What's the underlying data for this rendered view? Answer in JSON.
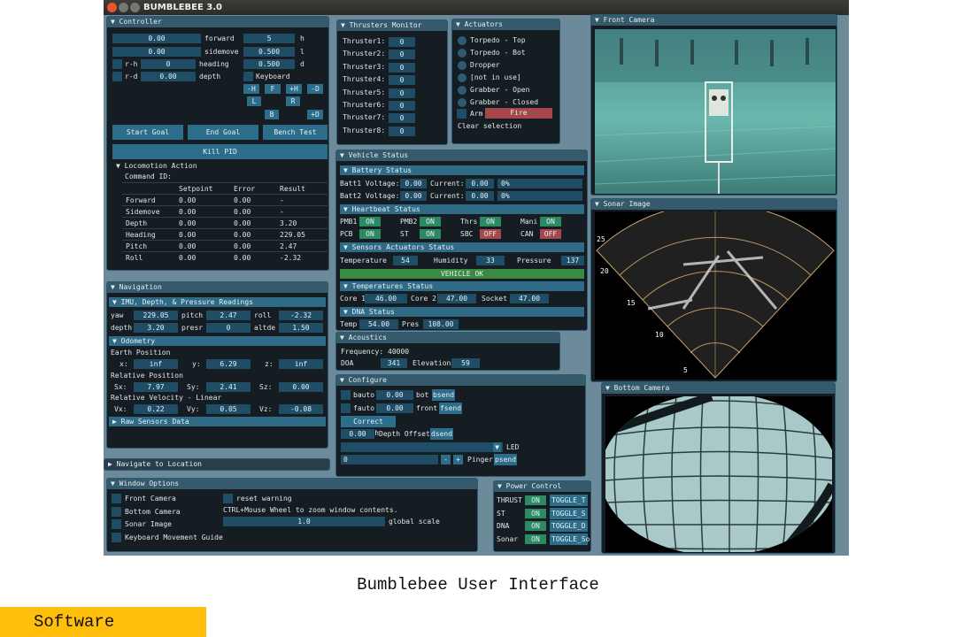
{
  "app": {
    "title": "BUMBLEBEE 3.0"
  },
  "caption": "Bumblebee User Interface",
  "tag": "Software",
  "colors": {
    "accent": "#2d6d8c",
    "on": "#2c8a63",
    "off": "#a5484b",
    "ok": "#3a8a43"
  },
  "controller": {
    "title": "Controller",
    "forward": {
      "value": "0.00",
      "label": "forward"
    },
    "sidemove": {
      "value": "0.00",
      "label": "sidemove"
    },
    "heading": {
      "check": "r-h",
      "value": "0",
      "label": "heading"
    },
    "depth": {
      "check": "r-d",
      "value": "0.00",
      "label": "depth"
    },
    "h": {
      "value": "5",
      "label": "h"
    },
    "l": {
      "value": "0.500",
      "label": "l"
    },
    "d": {
      "value": "0.500",
      "label": "d"
    },
    "keyboard": "Keyboard",
    "keys": [
      "-H",
      "F",
      "+H",
      "-D",
      "L",
      "R",
      "B",
      "+D"
    ],
    "start_goal": "Start Goal",
    "end_goal": "End Goal",
    "bench_test": "Bench Test",
    "kill_pid": "Kill PID",
    "locomotion": "Locomotion Action",
    "command_id": "Command ID:",
    "table_headers": [
      "",
      "Setpoint",
      "Error",
      "Result"
    ],
    "table_rows": [
      [
        "Forward",
        "0.00",
        "0.00",
        "-"
      ],
      [
        "Sidemove",
        "0.00",
        "0.00",
        "-"
      ],
      [
        "Depth",
        "0.00",
        "0.00",
        "3.20"
      ],
      [
        "Heading",
        "0.00",
        "0.00",
        "229.05"
      ],
      [
        "Pitch",
        "0.00",
        "0.00",
        "2.47"
      ],
      [
        "Roll",
        "0.00",
        "0.00",
        "-2.32"
      ]
    ]
  },
  "thrusters": {
    "title": "Thrusters Monitor",
    "items": [
      {
        "label": "Thruster1:",
        "value": "0"
      },
      {
        "label": "Thruster2:",
        "value": "0"
      },
      {
        "label": "Thruster3:",
        "value": "0"
      },
      {
        "label": "Thruster4:",
        "value": "0"
      },
      {
        "label": "Thruster5:",
        "value": "0"
      },
      {
        "label": "Thruster6:",
        "value": "0"
      },
      {
        "label": "Thruster7:",
        "value": "0"
      },
      {
        "label": "Thruster8:",
        "value": "0"
      }
    ]
  },
  "actuators": {
    "title": "Actuators",
    "items": [
      "Torpedo - Top",
      "Torpedo - Bot",
      "Dropper",
      "[not in use]",
      "Grabber - Open",
      "Grabber - Closed"
    ],
    "arm": "Arm",
    "fire": "Fire",
    "clear": "Clear selection"
  },
  "front_camera": {
    "title": "Front Camera"
  },
  "sonar": {
    "title": "Sonar Image",
    "ranges": [
      "25",
      "20",
      "15",
      "10",
      "5"
    ]
  },
  "bottom_camera": {
    "title": "Bottom Camera"
  },
  "vehicle": {
    "title": "Vehicle Status",
    "battery": {
      "title": "Battery Status",
      "rows": [
        {
          "label": "Batt1 Voltage:",
          "voltage": "0.00",
          "current_label": "Current:",
          "current": "0.00",
          "percent": "0%"
        },
        {
          "label": "Batt2 Voltage:",
          "voltage": "0.00",
          "current_label": "Current:",
          "current": "0.00",
          "percent": "0%"
        }
      ]
    },
    "heartbeat": {
      "title": "Heartbeat Status",
      "items": [
        {
          "label": "PMB1",
          "state": "ON"
        },
        {
          "label": "PMB2",
          "state": "ON"
        },
        {
          "label": "Thrs",
          "state": "ON"
        },
        {
          "label": "Mani",
          "state": "ON"
        },
        {
          "label": "PCB",
          "state": "ON"
        },
        {
          "label": "ST",
          "state": "ON"
        },
        {
          "label": "SBC",
          "state": "OFF"
        },
        {
          "label": "CAN",
          "state": "OFF"
        }
      ]
    },
    "sensors": {
      "title": "Sensors Actuators Status",
      "temperature_label": "Temperature",
      "temperature": "54",
      "humidity_label": "Humidity",
      "humidity": "33",
      "pressure_label": "Pressure",
      "pressure": "137",
      "vehicle_ok": "VEHICLE OK"
    },
    "temperatures": {
      "title": "Temperatures Status",
      "core1_label": "Core 1",
      "core1": "46.00",
      "core2_label": "Core 2",
      "core2": "47.00",
      "socket_label": "Socket",
      "socket": "47.00"
    },
    "dna": {
      "title": "DNA Status",
      "temp_label": "Temp",
      "temp": "54.00",
      "pres_label": "Pres",
      "pres": "108.00"
    }
  },
  "navigation": {
    "title": "Navigation",
    "imu": {
      "title": "IMU, Depth, & Pressure Readings",
      "yaw_label": "yaw",
      "yaw": "229.05",
      "pitch_label": "pitch",
      "pitch": "2.47",
      "roll_label": "roll",
      "roll": "-2.32",
      "depth_label": "depth",
      "depth": "3.20",
      "presr_label": "presr",
      "presr": "0",
      "altde_label": "altde",
      "altde": "1.50"
    },
    "odometry": {
      "title": "Odometry",
      "earth_label": "Earth Position",
      "x_label": "x:",
      "x": "inf",
      "y_label": "y:",
      "y": "6.29",
      "z_label": "z:",
      "z": "inf",
      "relative_label": "Relative Position",
      "sx_label": "Sx:",
      "sx": "7.97",
      "sy_label": "Sy:",
      "sy": "2.41",
      "sz_label": "Sz:",
      "sz": "0.00",
      "velocity_label": "Relative Velocity - Linear",
      "vx_label": "Vx:",
      "vx": "0.22",
      "vy_label": "Vy:",
      "vy": "0.05",
      "vz_label": "Vz:",
      "vz": "-0.08"
    },
    "raw": "Raw Sensors Data"
  },
  "navigate_to": {
    "title": "Navigate to Location"
  },
  "acoustics": {
    "title": "Acoustics",
    "frequency_label": "Frequency:",
    "frequency": "40000",
    "doa_label": "DOA",
    "doa": "341",
    "elevation_label": "Elevation",
    "elevation": "59"
  },
  "configure": {
    "title": "Configure",
    "bauto": "bauto",
    "bauto_value": "0.00",
    "bot": "bot",
    "bsend": "bsend",
    "fauto": "fauto",
    "fauto_value": "0.00",
    "front": "front",
    "fsend": "fsend",
    "correct_depth": "Correct depth",
    "depth_offset_value": "0.00",
    "depth_offset": "Depth Offset",
    "dsend": "dsend",
    "led": "LED",
    "pinger_value": "0",
    "minus": "-",
    "plus": "+",
    "pinger": "Pinger",
    "psend": "psend"
  },
  "window_options": {
    "title": "Window Options",
    "items": [
      "Front Camera",
      "Bottom Camera",
      "Sonar Image",
      "Keyboard Movement Guide"
    ],
    "reset_warning": "reset warning",
    "zoom_hint": "CTRL+Mouse Wheel to zoom window contents.",
    "global_scale_value": "1.0",
    "global_scale": "global scale"
  },
  "power": {
    "title": "Power Control",
    "rows": [
      {
        "label": "THRUST",
        "state": "ON",
        "toggle": "TOGGLE_T"
      },
      {
        "label": "ST",
        "state": "ON",
        "toggle": "TOGGLE_S"
      },
      {
        "label": "DNA",
        "state": "ON",
        "toggle": "TOGGLE_D"
      },
      {
        "label": "Sonar",
        "state": "ON",
        "toggle": "TOGGLE_So"
      }
    ]
  }
}
